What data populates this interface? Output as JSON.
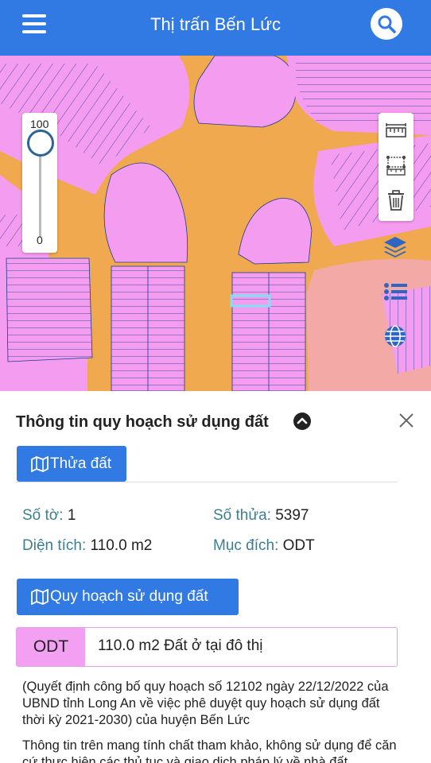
{
  "header": {
    "title": "Thị trấn Bến Lức"
  },
  "map": {
    "opacity_max": "100",
    "opacity_min": "0",
    "opacity_value": 100,
    "colors": {
      "residential": "#f49cf0",
      "road": "#f0a94e",
      "parcel_line": "#1c3b8f",
      "public": "#f3a9a5",
      "selected": "#7fe0f5"
    }
  },
  "panel": {
    "title": "Thông tin quy hoạch sử dụng đất",
    "parcel_tab": "Thửa đất",
    "sheet_label": "Số tờ:",
    "sheet_value": "1",
    "parcel_label": "Số thửa:",
    "parcel_value": "5397",
    "area_label": "Diện tích:",
    "area_value": "110.0 m2",
    "purpose_label": "Mục đích:",
    "purpose_value": "ODT",
    "planning_tab": "Quy hoạch sử dụng đất",
    "zone_code": "ODT",
    "zone_desc": "110.0 m2 Đất ở tại đô thị",
    "decision_text": "(Quyết định công bố quy hoạch số 12102 ngày 22/12/2022 của UBND tỉnh Long An về việc phê duyệt quy hoạch sử dụng đất thời kỳ 2021-2030) của huyện Bến Lức",
    "disclaimer_text": "Thông tin trên mang tính chất tham khảo, không sử dụng để căn cứ thực hiện các thủ tục và giao dịch pháp lý về nhà đất"
  },
  "icons": {
    "menu": "menu-icon",
    "search": "search-icon",
    "measure_distance": "ruler-icon",
    "measure_area": "area-measure-icon",
    "delete": "trash-icon",
    "layers": "layers-icon",
    "legend": "list-icon",
    "globe": "globe-icon",
    "collapse": "chevron-up-icon",
    "close": "close-icon",
    "map": "map-icon"
  }
}
